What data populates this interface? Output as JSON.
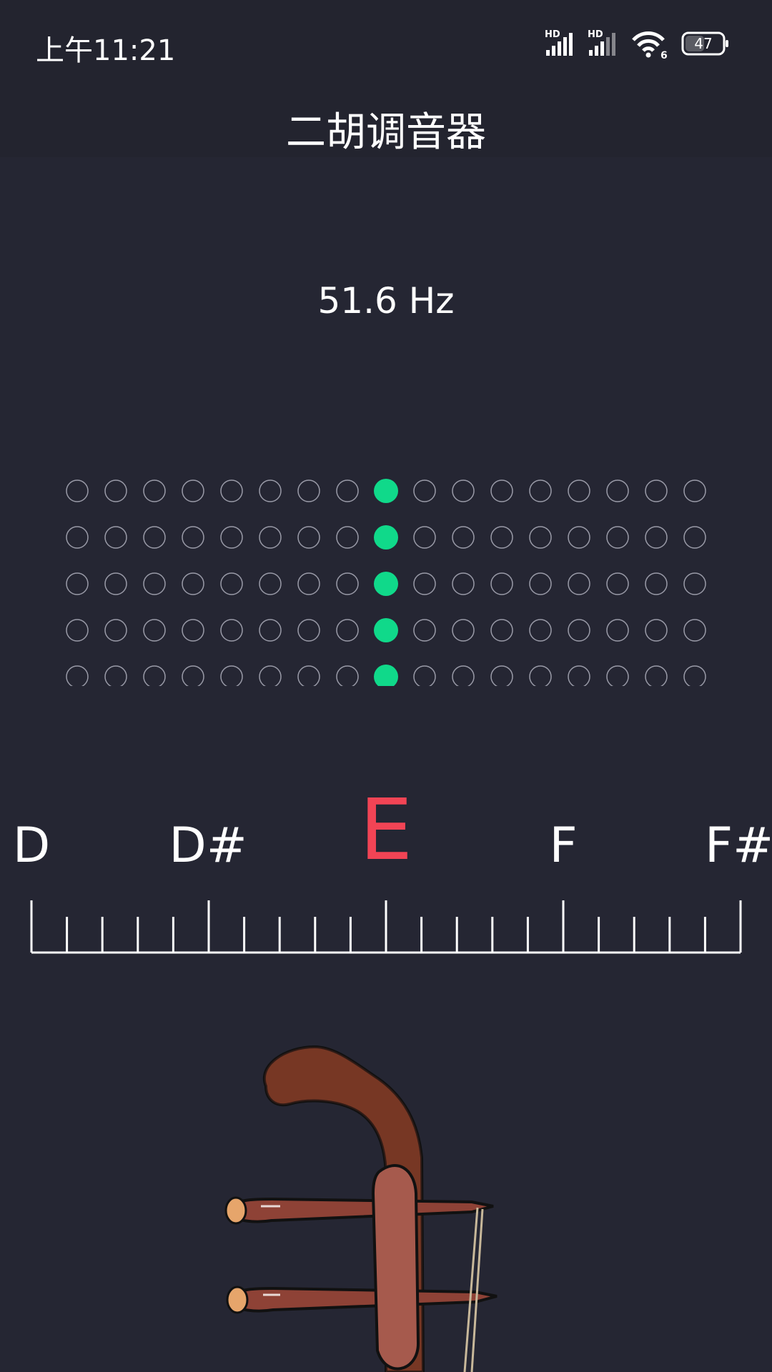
{
  "status_bar": {
    "time": "上午11:21",
    "signal_label_1": "HD",
    "signal_label_2": "HD",
    "wifi_badge": "6",
    "battery": "47"
  },
  "app": {
    "title": "二胡调音器"
  },
  "tuner": {
    "frequency": "51.6 Hz",
    "meter": {
      "rows": 5,
      "columns": 17,
      "active_column": 9,
      "active_color": "#10d98a",
      "inactive_color": "#9a9ba8"
    },
    "notes": [
      {
        "label": "D",
        "current": false
      },
      {
        "label": "D#",
        "current": false
      },
      {
        "label": "E",
        "current": true
      },
      {
        "label": "F",
        "current": false
      },
      {
        "label": "F#",
        "current": false
      }
    ],
    "current_note_color": "#f24455"
  },
  "colors": {
    "background": "#252633",
    "bar_background": "#23242f",
    "text": "#ffffff"
  }
}
